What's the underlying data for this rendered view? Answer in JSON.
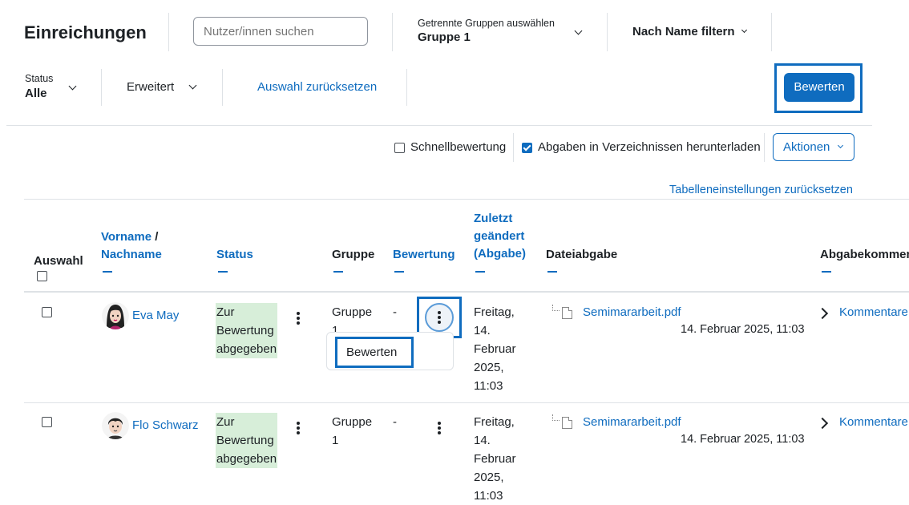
{
  "header": {
    "title": "Einreichungen",
    "search_placeholder": "Nutzer/innen suchen",
    "group_select_label": "Getrennte Gruppen auswählen",
    "group_select_value": "Gruppe 1",
    "name_filter_label": "Nach Name filtern"
  },
  "filters": {
    "status_label": "Status",
    "status_value": "Alle",
    "advanced_label": "Erweitert",
    "reset_label": "Auswahl zurücksetzen",
    "grade_button": "Bewerten"
  },
  "options": {
    "quick_grading_label": "Schnellbewertung",
    "quick_grading_checked": false,
    "download_folders_label": "Abgaben in Verzeichnissen herunterladen",
    "download_folders_checked": true,
    "actions_label": "Aktionen"
  },
  "table": {
    "reset_settings_label": "Tabelleneinstellungen zurücksetzen",
    "columns": {
      "select": "Auswahl",
      "firstname": "Vorname",
      "name_sep": "/",
      "lastname": "Nachname",
      "status": "Status",
      "group": "Gruppe",
      "grade": "Bewertung",
      "modified_1": "Zuletzt",
      "modified_2": "geändert",
      "modified_3": "(Abgabe)",
      "file_submission": "Dateiabgabe",
      "comments": "Abgabekommentare"
    },
    "rows": [
      {
        "name": "Eva May",
        "status": [
          "Zur",
          "Bewertung",
          "abgegeben"
        ],
        "group": [
          "Gruppe",
          "1"
        ],
        "grade": "-",
        "modified": [
          "Freitag,",
          "14.",
          "Februar",
          "2025,",
          "11:03"
        ],
        "file_name": "Semimararbeit.pdf",
        "file_date": "14. Februar 2025, 11:03",
        "comments_label": "Kommentare"
      },
      {
        "name": "Flo Schwarz",
        "status": [
          "Zur",
          "Bewertung",
          "abgegeben"
        ],
        "group": [
          "Gruppe",
          "1"
        ],
        "grade": "-",
        "modified": [
          "Freitag,",
          "14.",
          "Februar",
          "2025,",
          "11:03"
        ],
        "file_name": "Semimararbeit.pdf",
        "file_date": "14. Februar 2025, 11:03",
        "comments_label": "Kommentare"
      }
    ],
    "row_menu": {
      "item": "Bewerten"
    }
  },
  "colors": {
    "accent": "#0f6cbf",
    "status_bg": "#d7eed9"
  }
}
